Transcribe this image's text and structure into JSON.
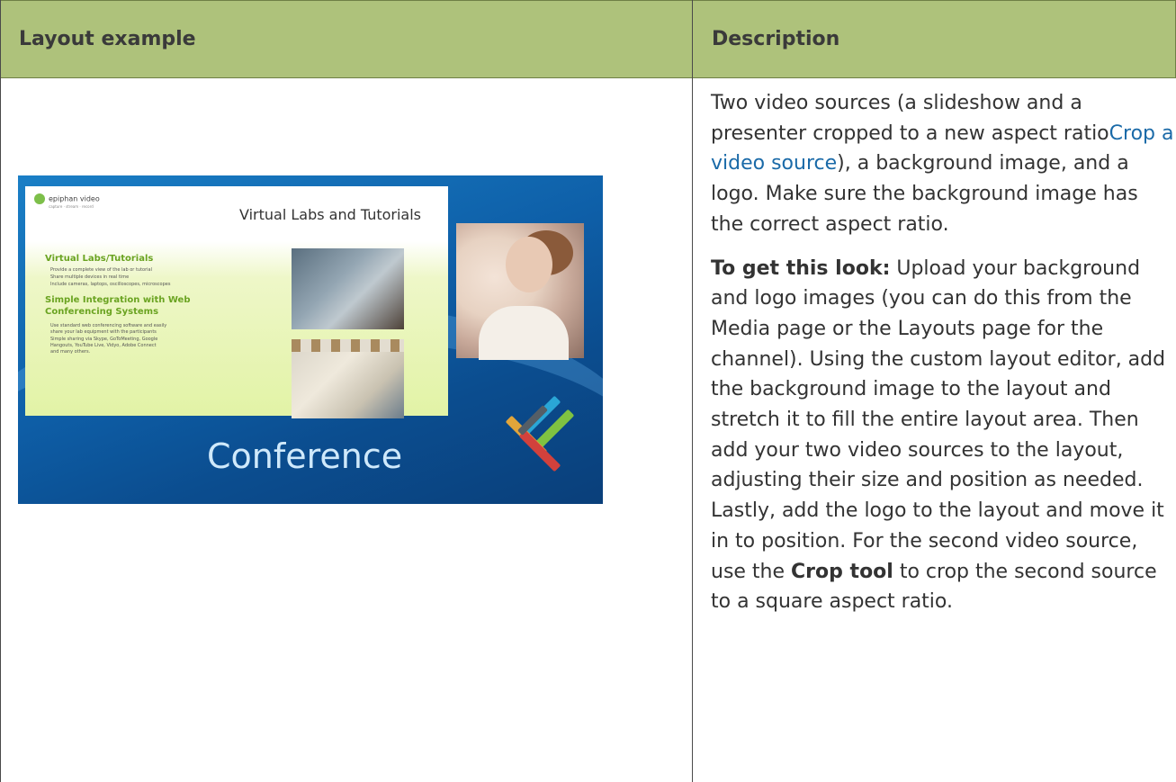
{
  "table": {
    "headers": {
      "col1": "Layout example",
      "col2": "Description"
    },
    "row1": {
      "screenshot": {
        "slide_logo": "epiphan video",
        "slide_tagline": "capture · stream · record",
        "slide_title": "Virtual Labs and Tutorials",
        "heading1": "Virtual Labs/Tutorials",
        "bullets1": [
          "Provide a complete view of the lab or tutorial",
          "Share multiple devices in real time",
          "Include cameras, laptops, oscilloscopes, microscopes"
        ],
        "heading2_line1": "Simple Integration with Web",
        "heading2_line2": "Conferencing Systems",
        "bullets2": [
          "Use standard web conferencing software and easily",
          "share your lab equipment with the participants",
          "Simple sharing via Skype, GoToMeeting, Google",
          "Hangouts, YouTube Live, Vidyo, Adobe Connect",
          "and many others."
        ],
        "caption": "Conference"
      },
      "description": {
        "p1_before_link": "Two video sources (a slideshow and a presenter cropped to a new aspect ratio",
        "p1_link": "Crop a video source",
        "p1_after_link": "), a background image, and a logo. Make sure the background image has the correct aspect ratio.",
        "p2_bold": "To get this look:",
        "p2_part1": " Upload your background and logo images (you can do this from the Media page or the Layouts page for the channel). Using the custom layout editor, add the background image to the layout and stretch it to fill the entire layout area. Then add your two video sources to the layout, adjusting their size and position as needed. Lastly, add the logo to the layout and move it in to position. For the second video source, use the ",
        "p2_bold2": "Crop tool",
        "p2_part2": " to crop the second source to a square aspect ratio."
      }
    },
    "colors": {
      "header_bg": "#aec27b",
      "link": "#1a6aa8",
      "slide_green": "#6aa321"
    }
  }
}
